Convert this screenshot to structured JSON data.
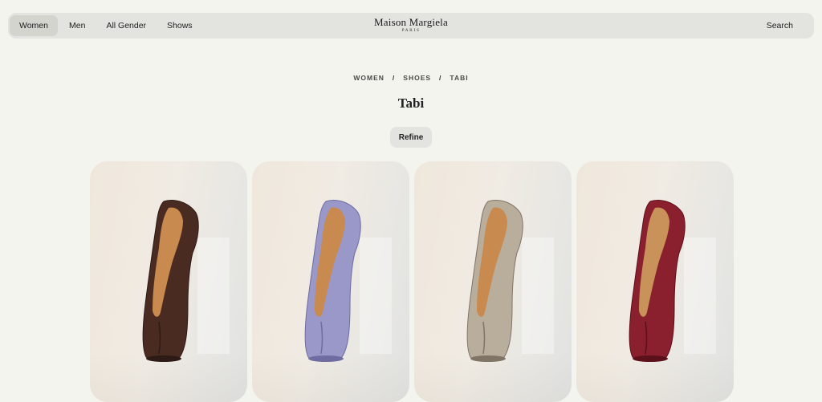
{
  "header": {
    "nav": [
      "Women",
      "Men",
      "All Gender",
      "Shows"
    ],
    "logo_main": "Maison Margiela",
    "logo_sub": "PARIS",
    "search_label": "Search"
  },
  "breadcrumb": [
    "WOMEN",
    "SHOES",
    "TABI"
  ],
  "breadcrumb_separator": "/",
  "page_title": "Tabi",
  "refine_label": "Refine",
  "products": [
    {
      "name": "product-card-brown",
      "upper": "#4a2b22",
      "upper_dark": "#2e1a15",
      "lining": "#c98a4f"
    },
    {
      "name": "product-card-lavender",
      "upper": "#9a98c9",
      "upper_dark": "#6e6ca0",
      "lining": "#c98a4f"
    },
    {
      "name": "product-card-metallic",
      "upper": "#b9ad9c",
      "upper_dark": "#7f7466",
      "lining": "#c98a4f"
    },
    {
      "name": "product-card-burgundy",
      "upper": "#8a1f2e",
      "upper_dark": "#5c1019",
      "lining": "#c9925a"
    }
  ]
}
